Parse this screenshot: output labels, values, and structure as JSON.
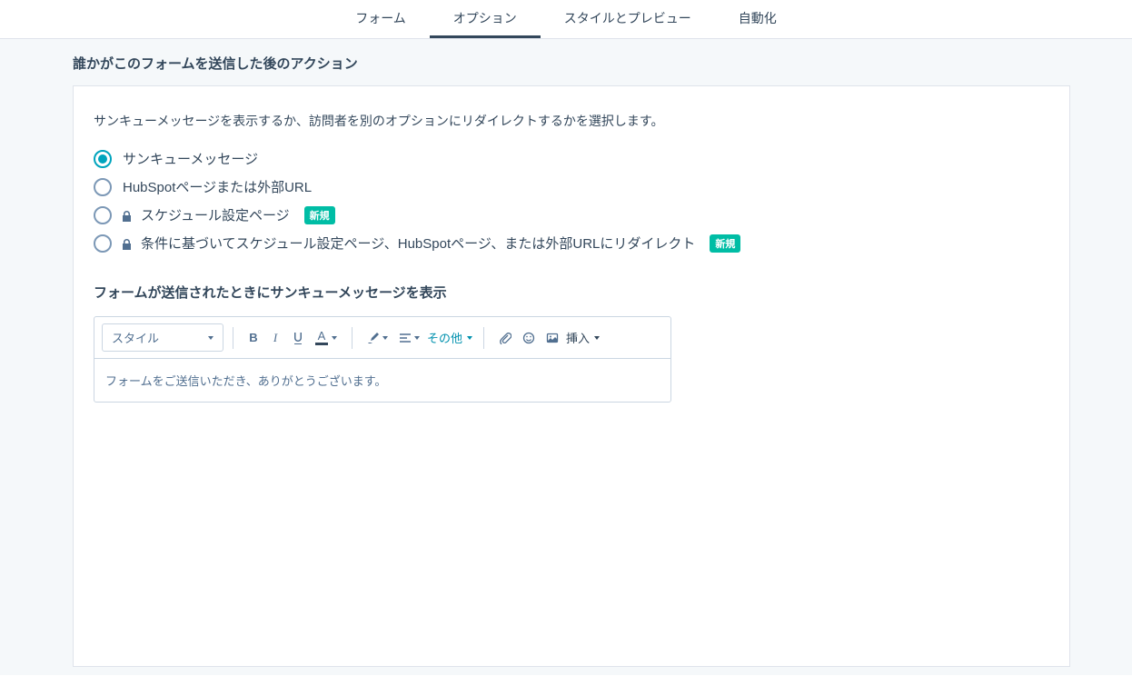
{
  "tabs": {
    "items": [
      {
        "label": "フォーム"
      },
      {
        "label": "オプション"
      },
      {
        "label": "スタイルとプレビュー"
      },
      {
        "label": "自動化"
      }
    ]
  },
  "section": {
    "title": "誰かがこのフォームを送信した後のアクション",
    "intro": "サンキューメッセージを表示するか、訪問者を別のオプションにリダイレクトするかを選択します。"
  },
  "radios": {
    "opt1": "サンキューメッセージ",
    "opt2": "HubSpotページまたは外部URL",
    "opt3": "スケジュール設定ページ",
    "opt3_badge": "新規",
    "opt4": "条件に基づいてスケジュール設定ページ、HubSpotページ、または外部URLにリダイレクト",
    "opt4_badge": "新規"
  },
  "subsection": {
    "title": "フォームが送信されたときにサンキューメッセージを表示"
  },
  "toolbar": {
    "style_select": "スタイル",
    "bold": "B",
    "italic": "I",
    "text_color_letter": "A",
    "more": "その他",
    "insert": "挿入"
  },
  "editor": {
    "content": "フォームをご送信いただき、ありがとうございます。"
  }
}
